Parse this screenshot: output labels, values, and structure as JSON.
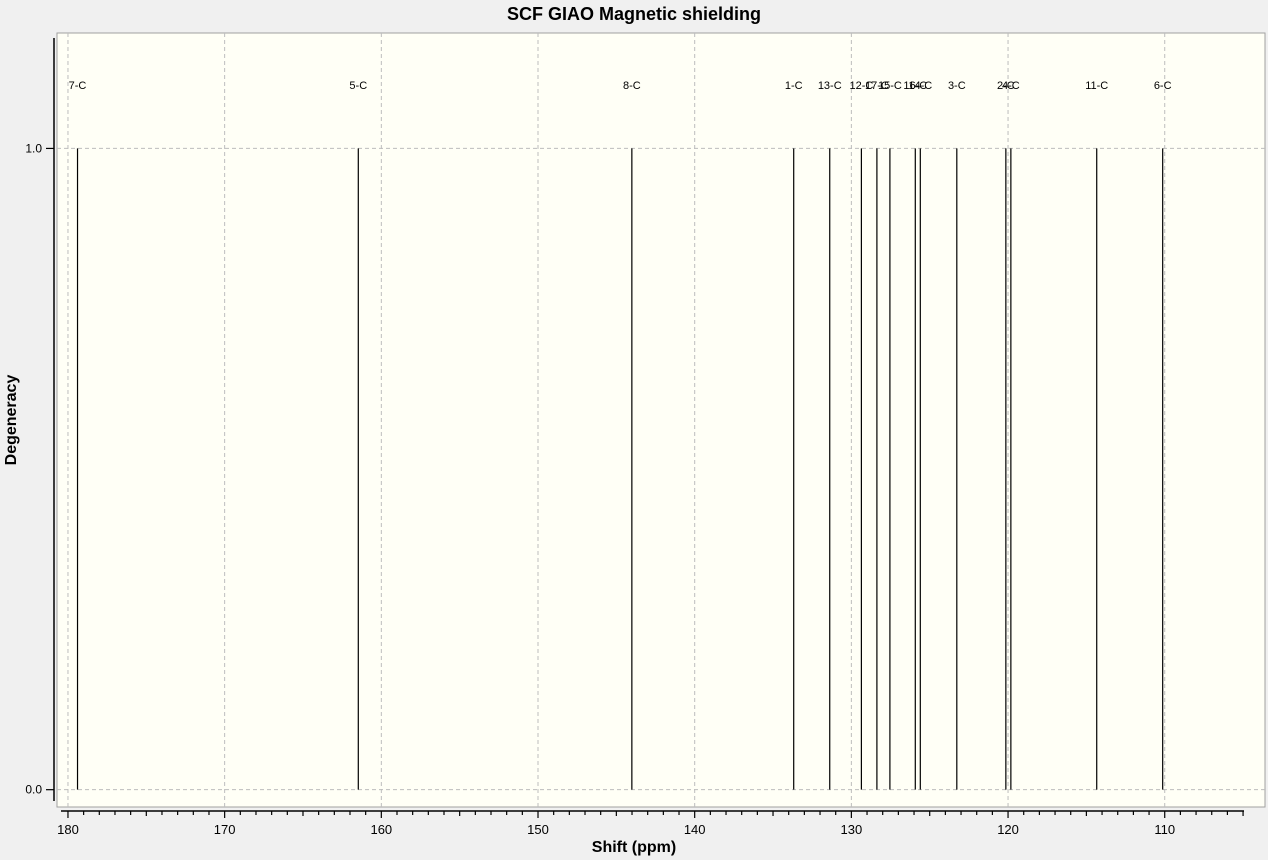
{
  "chart_data": {
    "type": "bar",
    "title": "SCF GIAO Magnetic shielding",
    "xlabel": "Shift (ppm)",
    "ylabel": "Degeneracy",
    "xlim": [
      180.7,
      103.6
    ],
    "ylim": [
      -0.027,
      1.18
    ],
    "x_ticks": [
      180,
      170,
      160,
      150,
      140,
      130,
      120,
      110
    ],
    "y_ticks": [
      "0.0",
      "1.0"
    ],
    "grid": true,
    "peaks": [
      {
        "label": "7-C",
        "shift": 179.39,
        "degeneracy": 1
      },
      {
        "label": "5-C",
        "shift": 161.47,
        "degeneracy": 1
      },
      {
        "label": "8-C",
        "shift": 144.01,
        "degeneracy": 1
      },
      {
        "label": "1-C",
        "shift": 133.68,
        "degeneracy": 1
      },
      {
        "label": "13-C",
        "shift": 131.38,
        "degeneracy": 1
      },
      {
        "label": "12-C",
        "shift": 129.36,
        "degeneracy": 1
      },
      {
        "label": "17-C",
        "shift": 128.37,
        "degeneracy": 1
      },
      {
        "label": "15-C",
        "shift": 127.54,
        "degeneracy": 1
      },
      {
        "label": "16-C",
        "shift": 125.92,
        "degeneracy": 1
      },
      {
        "label": "14-C",
        "shift": 125.6,
        "degeneracy": 1
      },
      {
        "label": "3-C",
        "shift": 123.27,
        "degeneracy": 1
      },
      {
        "label": "2-C",
        "shift": 120.14,
        "degeneracy": 1
      },
      {
        "label": "4-C",
        "shift": 119.82,
        "degeneracy": 1
      },
      {
        "label": "11-C",
        "shift": 114.34,
        "degeneracy": 1
      },
      {
        "label": "6-C",
        "shift": 110.13,
        "degeneracy": 1
      }
    ],
    "colors": {
      "plot_background": "#fffff6",
      "peak": "#000000",
      "grid": "#bdbdbd"
    }
  }
}
